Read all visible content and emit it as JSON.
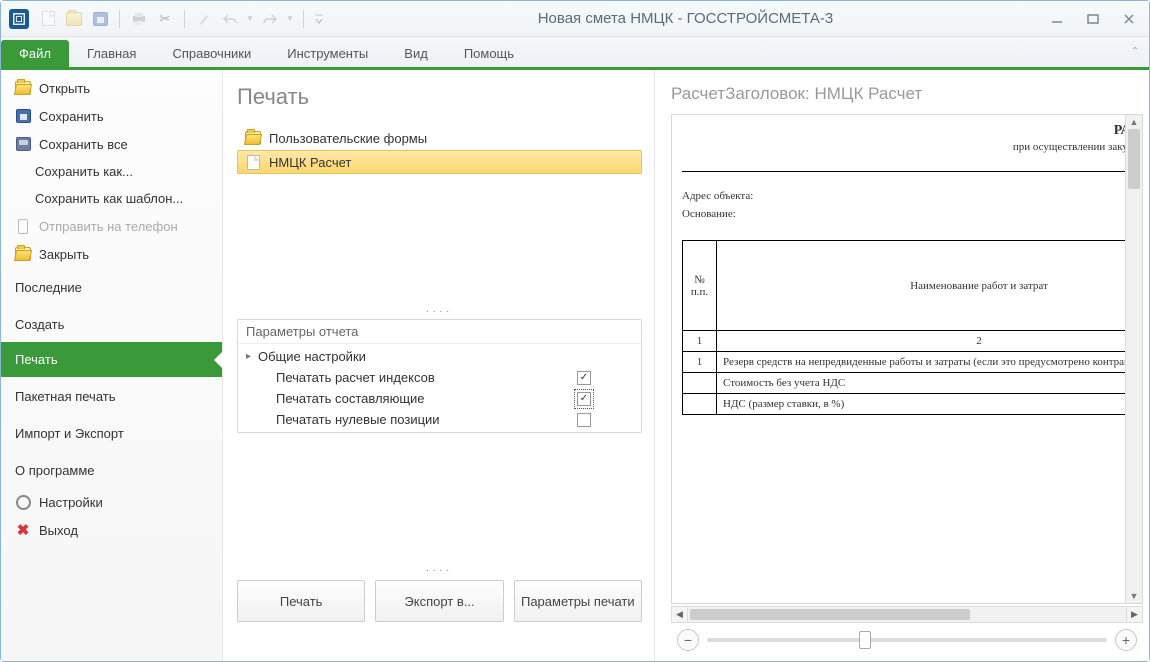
{
  "window": {
    "title": "Новая смета НМЦК - ГОССТРОЙСМЕТА-3"
  },
  "ribbon": {
    "tabs": [
      "Файл",
      "Главная",
      "Справочники",
      "Инструменты",
      "Вид",
      "Помощь"
    ],
    "active": 0
  },
  "backstage": {
    "open": "Открыть",
    "save": "Сохранить",
    "save_all": "Сохранить все",
    "save_as": "Сохранить как...",
    "save_as_template": "Сохранить как шаблон...",
    "send_to_phone": "Отправить на телефон",
    "close": "Закрыть",
    "recent": "Последние",
    "create": "Создать",
    "print": "Печать",
    "batch_print": "Пакетная печать",
    "import_export": "Импорт и Экспорт",
    "about": "О программе",
    "settings": "Настройки",
    "exit": "Выход"
  },
  "mid": {
    "title": "Печать",
    "user_forms": "Пользовательские формы",
    "selected_form": "НМЦК Расчет",
    "params_header": "Параметры отчета",
    "general": "Общие настройки",
    "p1": "Печатать расчет индексов",
    "p2": "Печатать составляющие",
    "p3": "Печатать нулевые позиции",
    "p1_checked": true,
    "p2_checked": true,
    "p3_checked": false,
    "btn_print": "Печать",
    "btn_export": "Экспорт в...",
    "btn_print_params": "Параметры печати"
  },
  "preview": {
    "header": "РасчетЗаголовок: НМЦК Расчет",
    "doc_title": "РАСЧЕТ НАЧАЛЬН",
    "doc_subtitle": "при осуществлении закупок работ по подготовке",
    "addr_label": "Адрес объекта:",
    "basis_label": "Основание:",
    "th_num": "№ п.п.",
    "th_name": "Наименование работ и затрат",
    "row_h1": "1",
    "row_h2": "2",
    "row1_n": "1",
    "row1_t": "Резерв средств на непредвиденные работы и затраты (если это предусмотрено контрактом)",
    "row2_t": "Стоимость без учета НДС",
    "row3_t": "НДС (размер ставки, в %)"
  }
}
